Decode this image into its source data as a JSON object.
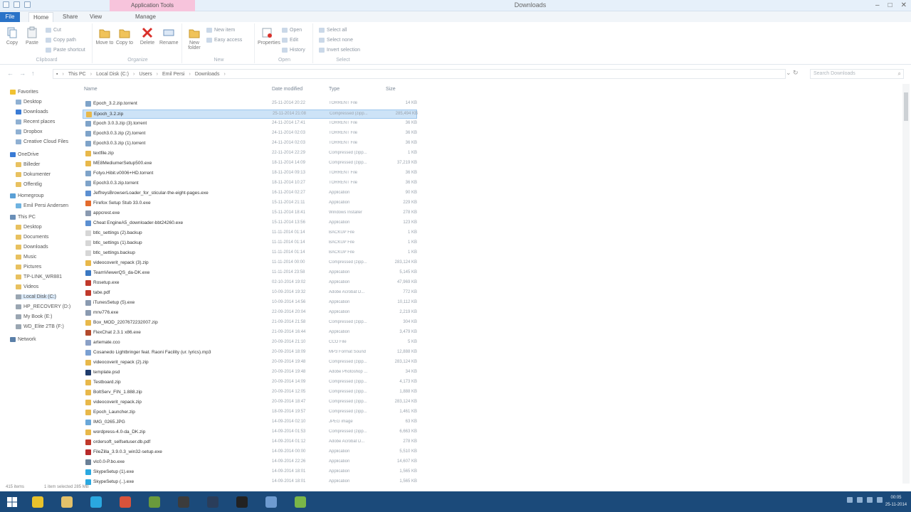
{
  "window": {
    "title": "Downloads",
    "context_tab": "Application Tools",
    "buttons": {
      "minimize": "–",
      "maximize": "□",
      "close": "✕"
    }
  },
  "tabs": {
    "file": "File",
    "home": "Home",
    "share": "Share",
    "view": "View",
    "manage": "Manage"
  },
  "ribbon": {
    "clipboard": {
      "label": "Clipboard",
      "copy": "Copy",
      "paste": "Paste",
      "cut": "Cut",
      "copy_path": "Copy path",
      "paste_shortcut": "Paste shortcut"
    },
    "organize": {
      "label": "Organize",
      "move_to": "Move to",
      "copy_to": "Copy to",
      "delete": "Delete",
      "rename": "Rename"
    },
    "new": {
      "label": "New",
      "new_folder": "New folder",
      "new_item": "New item",
      "easy_access": "Easy access"
    },
    "open": {
      "label": "Open",
      "properties": "Properties",
      "open": "Open",
      "edit": "Edit",
      "history": "History"
    },
    "select": {
      "label": "Select",
      "select_all": "Select all",
      "select_none": "Select none",
      "invert": "Invert selection"
    }
  },
  "address": {
    "crumbs": [
      "This PC",
      "Local Disk (C:)",
      "Users",
      "Emil Persi",
      "Downloads"
    ],
    "search_placeholder": "Search Downloads"
  },
  "nav": {
    "favorites": "Favorites",
    "fav_items": [
      "Desktop",
      "Downloads",
      "Recent places",
      "Dropbox",
      "Creative Cloud Files"
    ],
    "onedrive": "OneDrive",
    "od_items": [
      "Billeder",
      "Dokumenter",
      "Offentlig"
    ],
    "homegroup": "Homegroup",
    "hg_items": [
      "Emil Persi Andersen"
    ],
    "thispc": "This PC",
    "pc_items": [
      "Desktop",
      "Documents",
      "Downloads",
      "Music",
      "Pictures",
      "TP-LINK_WR881",
      "Videos",
      "Local Disk (C:)",
      "HP_RECOVERY (D:)",
      "My Book (E:)",
      "WD_Elite 2TB (F:)"
    ],
    "network": "Network"
  },
  "columns": {
    "name": "Name",
    "date": "Date modified",
    "type": "Type",
    "size": "Size"
  },
  "files": [
    {
      "name": "Epoch_3.2.zip.torrent",
      "date": "25-11-2014 20:22",
      "type": "TORRENT File",
      "size": "14 KB",
      "color": "#7ea3c9"
    },
    {
      "name": "Epoch_3.2.zip",
      "date": "25-11-2014 21:08",
      "type": "Compressed (zipp...",
      "size": "285,494 KB",
      "color": "#e8b84a",
      "selected": true
    },
    {
      "name": "Epoch 3.0.3.zip (3).torrent",
      "date": "24-11-2014 17:41",
      "type": "TORRENT File",
      "size": "36 KB",
      "color": "#7ea3c9"
    },
    {
      "name": "Epoch3.0.3.zip (2).torrent",
      "date": "24-11-2014 02:03",
      "type": "TORRENT File",
      "size": "36 KB",
      "color": "#7ea3c9"
    },
    {
      "name": "Epoch3.0.3.zip (1).torrent",
      "date": "24-11-2014 02:03",
      "type": "TORRENT File",
      "size": "36 KB",
      "color": "#7ea3c9"
    },
    {
      "name": "textfile.zip",
      "date": "22-11-2014 22:29",
      "type": "Compressed (zipp...",
      "size": "1 KB",
      "color": "#e8b84a"
    },
    {
      "name": "ME8MediumerSetup500.exe",
      "date": "18-11-2014 14:09",
      "type": "Compressed (zipp...",
      "size": "37,219 KB",
      "color": "#e8b84a"
    },
    {
      "name": "Fotyo.Hibit.v0006+HD.torrent",
      "date": "18-11-2014 09:13",
      "type": "TORRENT File",
      "size": "36 KB",
      "color": "#7ea3c9"
    },
    {
      "name": "Epoch3.0.3.zip.torrent",
      "date": "18-11-2014 10:27",
      "type": "TORRENT File",
      "size": "36 KB",
      "color": "#7ea3c9"
    },
    {
      "name": "JeffreysBrowserLoader_for_sticular-the-eight-pages.exe",
      "date": "16-11-2014 02:27",
      "type": "Application",
      "size": "90 KB",
      "color": "#5b8fd1"
    },
    {
      "name": "Firefox Setup Stub 33.0.exe",
      "date": "15-11-2014 21:11",
      "type": "Application",
      "size": "229 KB",
      "color": "#e36b2c"
    },
    {
      "name": "appcrest.exe",
      "date": "15-11-2014 18:41",
      "type": "Windows Installer",
      "size": "278 KB",
      "color": "#8a9ab0"
    },
    {
      "name": "Cheat EngineA5_downloader-bbt24260.exe",
      "date": "15-11-2014 13:56",
      "type": "Application",
      "size": "123 KB",
      "color": "#5b8fd1"
    },
    {
      "name": "btlc_settings (2).backup",
      "date": "11-11-2014 01:14",
      "type": "BACKUP File",
      "size": "1 KB",
      "color": "#d6d6d6"
    },
    {
      "name": "btlc_settings (1).backup",
      "date": "11-11-2014 01:14",
      "type": "BACKUP File",
      "size": "1 KB",
      "color": "#d6d6d6"
    },
    {
      "name": "btlc_settings.backup",
      "date": "11-11-2014 01:14",
      "type": "BACKUP File",
      "size": "1 KB",
      "color": "#d6d6d6"
    },
    {
      "name": "videocoverit_repack (3).zip",
      "date": "11-11-2014 00:00",
      "type": "Compressed (zipp...",
      "size": "283,124 KB",
      "color": "#e8b84a"
    },
    {
      "name": "TeamViewerQS_da-DK.exe",
      "date": "11-11-2014 23:58",
      "type": "Application",
      "size": "5,145 KB",
      "color": "#3a78c2"
    },
    {
      "name": "Rosetup.exe",
      "date": "02-10-2014 19:02",
      "type": "Application",
      "size": "47,969 KB",
      "color": "#c0392b"
    },
    {
      "name": "tabe.pdf",
      "date": "10-09-2014 19:32",
      "type": "Adobe Acrobat D...",
      "size": "772 KB",
      "color": "#c0392b"
    },
    {
      "name": "iTunesSetup (5).exe",
      "date": "10-09-2014 14:56",
      "type": "Application",
      "size": "10,112 KB",
      "color": "#8a9ab0"
    },
    {
      "name": "mnv776.exe",
      "date": "22-09-2014 20:04",
      "type": "Application",
      "size": "2,219 KB",
      "color": "#8a9ab0"
    },
    {
      "name": "Box_MOD_2207672232007.zip",
      "date": "21-09-2014 21:58",
      "type": "Compressed (zipp...",
      "size": "304 KB",
      "color": "#e8b84a"
    },
    {
      "name": "FlexChat 2.3.1 x86.exe",
      "date": "21-09-2014 16:44",
      "type": "Application",
      "size": "3,479 KB",
      "color": "#b34a2c"
    },
    {
      "name": "artemate.cco",
      "date": "20-09-2014 21:10",
      "type": "CCO File",
      "size": "5 KB",
      "color": "#8aa0c6"
    },
    {
      "name": "Cosanedo Lightbringer feat. Raoni Facility (ur. lyrics).mp3",
      "date": "20-09-2014 18:09",
      "type": "MP3 Format Sound",
      "size": "12,888 KB",
      "color": "#7aa0d2"
    },
    {
      "name": "videocoverit_repack (2).zip",
      "date": "20-09-2014 19:48",
      "type": "Compressed (zipp...",
      "size": "283,124 KB",
      "color": "#e8b84a"
    },
    {
      "name": "template.psd",
      "date": "20-09-2014 19:48",
      "type": "Adobe Photoshop ...",
      "size": "34 KB",
      "color": "#1f3b6b"
    },
    {
      "name": "Testboard.zip",
      "date": "20-09-2014 14:09",
      "type": "Compressed (zipp...",
      "size": "4,173 KB",
      "color": "#e8b84a"
    },
    {
      "name": "BoltServ_FIN_1.888.zip",
      "date": "20-09-2014 12:05",
      "type": "Compressed (zipp...",
      "size": "1,888 KB",
      "color": "#e8b84a"
    },
    {
      "name": "videocoverit_repack.zip",
      "date": "20-09-2014 18:47",
      "type": "Compressed (zipp...",
      "size": "283,124 KB",
      "color": "#e8b84a"
    },
    {
      "name": "Epoch_Launcher.zip",
      "date": "18-09-2014 19:57",
      "type": "Compressed (zipp...",
      "size": "1,461 KB",
      "color": "#e8b84a"
    },
    {
      "name": "IMG_0265.JPG",
      "date": "14-09-2014 02:10",
      "type": "JPEG image",
      "size": "63 KB",
      "color": "#6aa7d8"
    },
    {
      "name": "wordpress-4.0-da_DK.zip",
      "date": "14-09-2014 01:53",
      "type": "Compressed (zipp...",
      "size": "6,663 KB",
      "color": "#e8b84a"
    },
    {
      "name": "ordersoft_selfsetuser.db.pdf",
      "date": "14-09-2014 01:12",
      "type": "Adobe Acrobat D...",
      "size": "278 KB",
      "color": "#c0392b"
    },
    {
      "name": "FileZilla_3.9.0.3_win32-setup.exe",
      "date": "14-09-2014 00:00",
      "type": "Application",
      "size": "5,510 KB",
      "color": "#b72a2a"
    },
    {
      "name": "vlc0.0-P.bo.exe",
      "date": "14-09-2014 22:26",
      "type": "Application",
      "size": "14,607 KB",
      "color": "#6a7f96"
    },
    {
      "name": "SkypeSetup (1).exe",
      "date": "14-09-2014 18:01",
      "type": "Application",
      "size": "1,565 KB",
      "color": "#2aa8e0"
    },
    {
      "name": "SkypeSetup (..).exe",
      "date": "14-09-2014 18:01",
      "type": "Application",
      "size": "1,565 KB",
      "color": "#2aa8e0"
    }
  ],
  "status": {
    "count": "415 items",
    "selected": "1 item selected  285 MB"
  },
  "taskbar": {
    "apps": [
      {
        "name": "chrome",
        "color": "#e8c22c"
      },
      {
        "name": "explorer",
        "color": "#e3c16a"
      },
      {
        "name": "skype",
        "color": "#2aa8e0"
      },
      {
        "name": "opera",
        "color": "#d9533b"
      },
      {
        "name": "minecraft",
        "color": "#6a9a3c"
      },
      {
        "name": "terminal",
        "color": "#3c3c3c"
      },
      {
        "name": "steam",
        "color": "#2a3d5a"
      },
      {
        "name": "unity",
        "color": "#222222"
      },
      {
        "name": "paint",
        "color": "#6e9bd0"
      },
      {
        "name": "utorrent",
        "color": "#7ab648"
      }
    ],
    "time": "00:05",
    "date": "25-11-2014"
  }
}
